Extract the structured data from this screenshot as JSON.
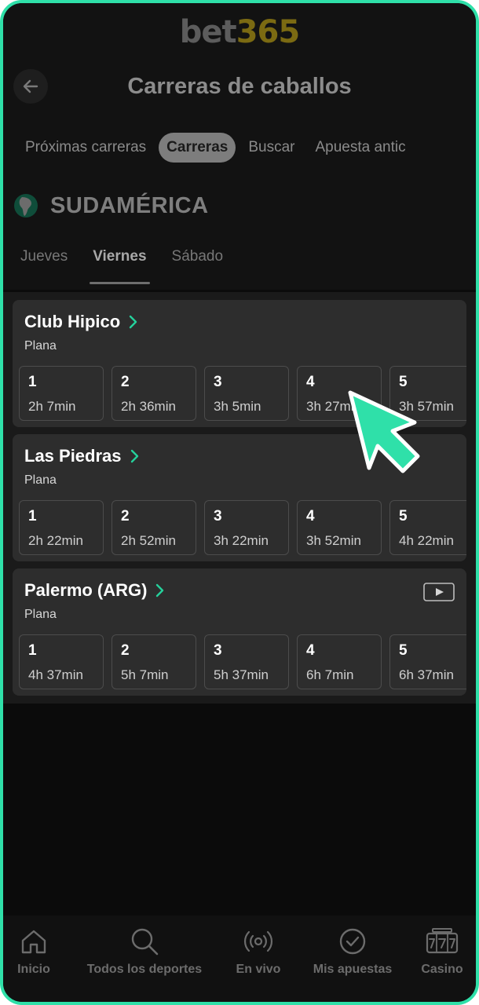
{
  "brand": {
    "logo_part1": "bet",
    "logo_part2": "365"
  },
  "header": {
    "title": "Carreras de caballos"
  },
  "tabs": [
    {
      "label": "Próximas carreras"
    },
    {
      "label": "Carreras"
    },
    {
      "label": "Buscar"
    },
    {
      "label": "Apuesta antic"
    }
  ],
  "region": {
    "name": "SUDAMÉRICA"
  },
  "days": [
    {
      "label": "Jueves"
    },
    {
      "label": "Viernes"
    },
    {
      "label": "Sábado"
    }
  ],
  "meetings": [
    {
      "name": "Club Hipico",
      "type": "Plana",
      "races": [
        {
          "num": "1",
          "time": "2h 7min"
        },
        {
          "num": "2",
          "time": "2h 36min"
        },
        {
          "num": "3",
          "time": "3h 5min"
        },
        {
          "num": "4",
          "time": "3h 27min"
        },
        {
          "num": "5",
          "time": "3h 57min"
        }
      ]
    },
    {
      "name": "Las Piedras",
      "type": "Plana",
      "races": [
        {
          "num": "1",
          "time": "2h 22min"
        },
        {
          "num": "2",
          "time": "2h 52min"
        },
        {
          "num": "3",
          "time": "3h 22min"
        },
        {
          "num": "4",
          "time": "3h 52min"
        },
        {
          "num": "5",
          "time": "4h 22min"
        }
      ]
    },
    {
      "name": "Palermo (ARG)",
      "type": "Plana",
      "races": [
        {
          "num": "1",
          "time": "4h 37min"
        },
        {
          "num": "2",
          "time": "5h 7min"
        },
        {
          "num": "3",
          "time": "5h 37min"
        },
        {
          "num": "4",
          "time": "6h 7min"
        },
        {
          "num": "5",
          "time": "6h 37min"
        }
      ]
    }
  ],
  "bottom_nav": [
    {
      "label": "Inicio",
      "icon": "home-icon"
    },
    {
      "label": "Todos los deportes",
      "icon": "search-icon"
    },
    {
      "label": "En vivo",
      "icon": "live-icon"
    },
    {
      "label": "Mis apuestas",
      "icon": "check-circle-icon"
    },
    {
      "label": "Casino",
      "icon": "slot-machine-icon"
    }
  ],
  "colors": {
    "frame_border": "#2fe0a9",
    "accent_green": "#25d09b",
    "card_bg": "#2d2d2d",
    "logo_yellow": "#7b6a12"
  }
}
